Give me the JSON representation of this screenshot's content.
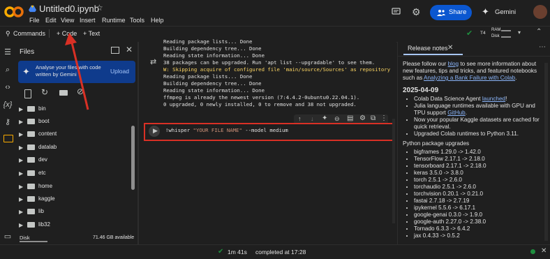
{
  "header": {
    "notebook_title": "Untitled0.ipynb",
    "menu": [
      "File",
      "Edit",
      "View",
      "Insert",
      "Runtime",
      "Tools",
      "Help"
    ],
    "share_label": "Share",
    "gemini_label": "Gemini"
  },
  "toolbar": {
    "commands_label": "Commands",
    "add_code_label": "+ Code",
    "add_text_label": "+ Text",
    "runtime_type": "T4",
    "ram_label": "RAM",
    "disk_label": "Disk"
  },
  "files_panel": {
    "title": "Files",
    "banner_text": "Analyse your files with code written by Gemini",
    "upload_label": "Upload",
    "folders": [
      "bin",
      "boot",
      "content",
      "datalab",
      "dev",
      "etc",
      "home",
      "kaggle",
      "lib",
      "lib32"
    ],
    "disk_label": "Disk",
    "disk_available": "71.46 GB available"
  },
  "output_lines": [
    "Reading package lists... Done",
    "Building dependency tree... Done",
    "Reading state information... Done",
    "38 packages can be upgraded. Run 'apt list --upgradable' to see them.",
    "W: Skipping acquire of configured file 'main/source/Sources' as repository",
    "Reading package lists... Done",
    "Building dependency tree... Done",
    "Reading state information... Done",
    "ffmpeg is already the newest version (7:4.4.2-0ubuntu0.22.04.1).",
    "0 upgraded, 0 newly installed, 0 to remove and 38 not upgraded."
  ],
  "cell": {
    "code_prefix": "!whisper ",
    "code_string": "\"YOUR FILE NAME\"",
    "code_suffix": " --model medium"
  },
  "release_notes": {
    "tab_label": "Release notes",
    "intro_before_link1": "Please follow our ",
    "link1": "blog",
    "intro_after_link1": " to see more information about new features, tips and tricks, and featured notebooks such as ",
    "link2": "Analyzing a Bank Failure with Colab",
    "intro_end": ".",
    "date": "2025-04-09",
    "bullets": [
      {
        "before": "Colab Data Science Agent ",
        "link": "launched",
        "after": "!"
      },
      {
        "before": "Julia language runtimes available with GPU and TPU support ",
        "link": "GitHub",
        "after": "."
      },
      {
        "before": "Now your popular Kaggle datasets are cached for quick retrieval.",
        "link": "",
        "after": ""
      },
      {
        "before": "Upgraded Colab runtimes to Python 3.11.",
        "link": "",
        "after": ""
      }
    ],
    "upgrades_title": "Python package upgrades",
    "upgrades": [
      "bigframes 1.29.0 -> 1.42.0",
      "TensorFlow 2.17.1 -> 2.18.0",
      "tensorboard 2.17.1 -> 2.18.0",
      "keras 3.5.0 -> 3.8.0",
      "torch 2.5.1 -> 2.6.0",
      "torchaudio 2.5.1 -> 2.6.0",
      "torchvision 0.20.1 -> 0.21.0",
      "fastai 2.7.18 -> 2.7.19",
      "ipykernel 5.5.6 -> 6.17.1",
      "google-genai 0.3.0 -> 1.9.0",
      "google-auth 2.27.0 -> 2.38.0",
      "Tornado 6.3.3 -> 6.4.2",
      "jax 0.4.33 -> 0.5.2"
    ]
  },
  "status_bar": {
    "elapsed": "1m 41s",
    "completed": "completed at 17:28"
  },
  "colors": {
    "accent_blue": "#0b57d0",
    "highlight_red": "#d93025",
    "status_green": "#1e8e3e",
    "string_orange": "#ce9178"
  }
}
